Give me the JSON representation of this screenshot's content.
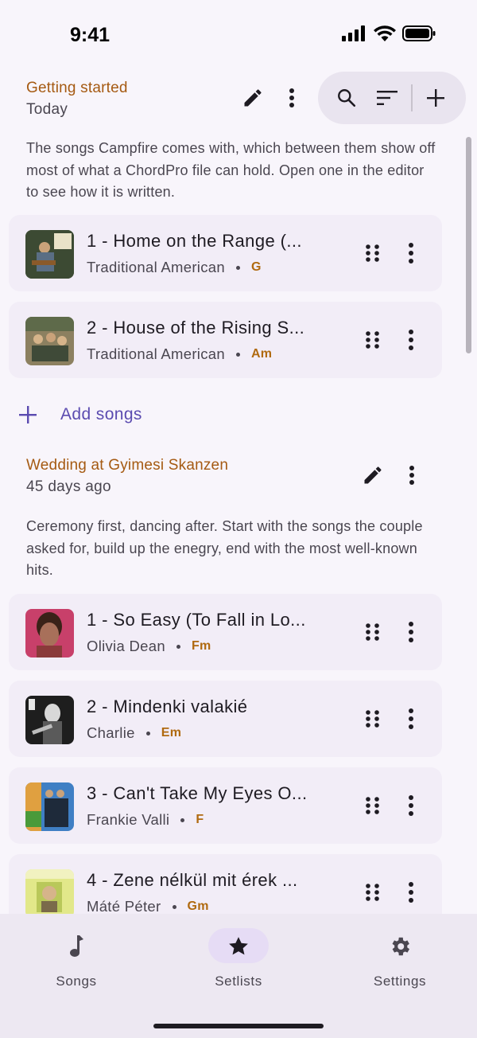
{
  "status": {
    "time": "9:41"
  },
  "setlists": [
    {
      "title": "Getting started",
      "date": "Today",
      "description": "The songs Campfire comes with, which between them show off most of what a ChordPro file can hold. Open one in the editor to see how it is written.",
      "songs": [
        {
          "title": "1 - Home on the Range (...",
          "artist": "Traditional American",
          "key": "G",
          "cover_color": "#6b7a5a"
        },
        {
          "title": "2 - House of the Rising S...",
          "artist": "Traditional American",
          "key": "Am",
          "cover_color": "#8a7b58"
        }
      ],
      "add_label": "Add songs"
    },
    {
      "title": "Wedding at Gyimesi Skanzen",
      "date": "45 days ago",
      "description": "Ceremony first, dancing after. Start with the songs the couple asked for, build up the enegry, end with the most well-known hits.",
      "songs": [
        {
          "title": "1 - So Easy (To Fall in Lo...",
          "artist": "Olivia Dean",
          "key": "Fm",
          "cover_color": "#c2456a"
        },
        {
          "title": "2 - Mindenki valakié",
          "artist": "Charlie",
          "key": "Em",
          "cover_color": "#2a2a2a"
        },
        {
          "title": "3 - Can't Take My Eyes O...",
          "artist": "Frankie Valli",
          "key": "F",
          "cover_color": "#3f7fc4"
        },
        {
          "title": "4 - Zene nélkül mit érek ...",
          "artist": "Máté Péter",
          "key": "Gm",
          "cover_color": "#d8e07a"
        }
      ]
    }
  ],
  "nav": {
    "items": [
      {
        "label": "Songs",
        "icon": "music-note-icon"
      },
      {
        "label": "Setlists",
        "icon": "star-icon",
        "selected": true
      },
      {
        "label": "Settings",
        "icon": "gear-icon"
      }
    ]
  },
  "colors": {
    "accent": "#5b4bb0",
    "title": "#a55a12",
    "key": "#b06a10",
    "background": "#f8f5fb"
  }
}
